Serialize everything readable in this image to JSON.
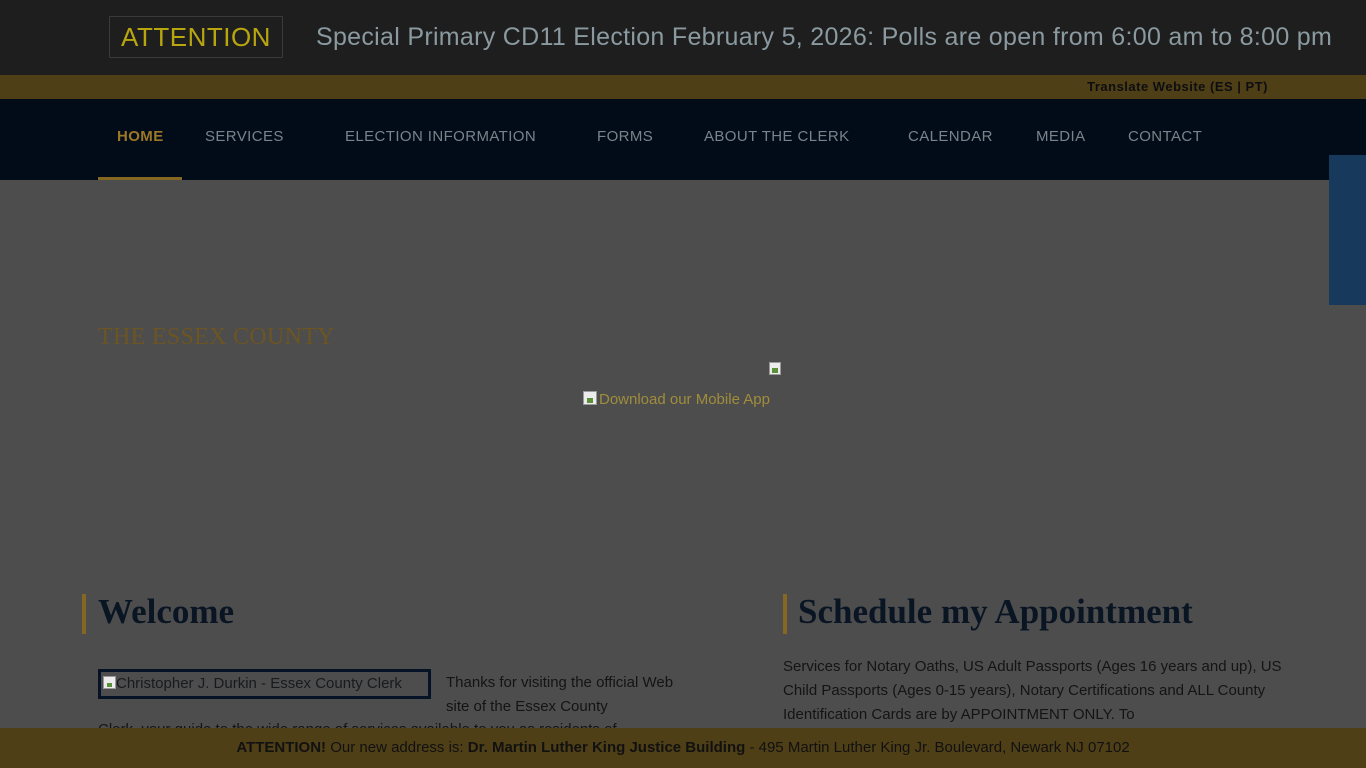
{
  "ticker": {
    "badge": "ATTENTION",
    "message": "Special Primary CD11 Election February 5, 2026: Polls are open from 6:00 am to 8:00 pm"
  },
  "translate": {
    "label": "Translate Website (ES | PT)"
  },
  "nav": {
    "items": [
      {
        "label": "HOME",
        "active": true
      },
      {
        "label": "SERVICES"
      },
      {
        "label": "ELECTION INFORMATION"
      },
      {
        "label": "FORMS"
      },
      {
        "label": "ABOUT THE CLERK"
      },
      {
        "label": "CALENDAR"
      },
      {
        "label": "MEDIA"
      },
      {
        "label": "CONTACT"
      }
    ]
  },
  "hero": {
    "title": "THE ESSEX COUNTY",
    "app_link_alt": "Download our Mobile App"
  },
  "welcome": {
    "heading": "Welcome",
    "portrait_alt": "Christopher J. Durkin - Essex County Clerk",
    "intro": "Thanks for visiting the official Web site of the Essex County",
    "continued": "Clerk, your guide to the wide range of services available to you as residents of"
  },
  "appointment": {
    "heading": "Schedule my Appointment",
    "text": "Services for Notary Oaths, US Adult Passports (Ages 16 years and up), US Child Passports (Ages 0-15 years), Notary Certifications and ALL County Identification Cards are by APPOINTMENT ONLY. To"
  },
  "bottom_notice": {
    "prefix": "ATTENTION!",
    "middle": " Our new address is: ",
    "building": "Dr. Martin Luther King Justice Building",
    "address": " - 495 Martin Luther King Jr. Boulevard, Newark NJ 07102"
  },
  "colors": {
    "accent_gold": "#866721",
    "nav_bg": "#020c19",
    "page_overlay": "#4d4d4d"
  }
}
